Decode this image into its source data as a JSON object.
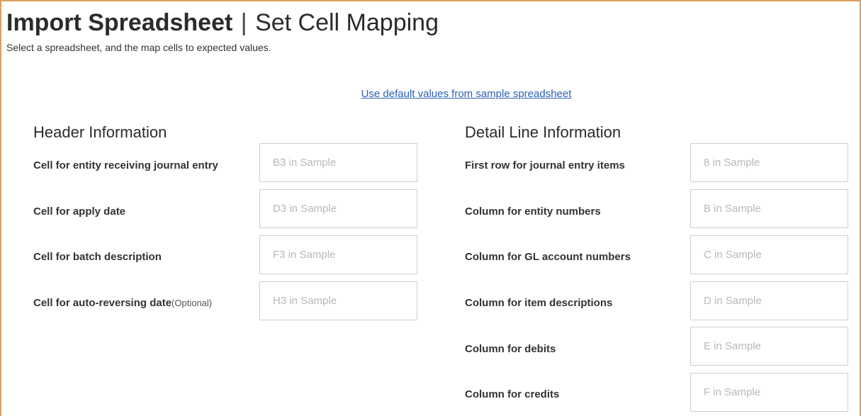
{
  "page": {
    "title_strong": "Import Spreadsheet",
    "title_separator": "|",
    "title_rest": "Set Cell Mapping",
    "subtitle": "Select a spreadsheet, and the map cells to expected values."
  },
  "default_link": "Use default values from sample spreadsheet",
  "header_section": {
    "heading": "Header Information",
    "fields": [
      {
        "label": "Cell for entity receiving journal entry",
        "placeholder": "B3 in Sample"
      },
      {
        "label": "Cell for apply date",
        "placeholder": "D3 in Sample"
      },
      {
        "label": "Cell for batch description",
        "placeholder": "F3 in Sample"
      },
      {
        "label": "Cell for auto-reversing date",
        "optional": "(Optional)",
        "placeholder": "H3 in Sample"
      }
    ]
  },
  "detail_section": {
    "heading": "Detail Line Information",
    "fields": [
      {
        "label": "First row for journal entry items",
        "placeholder": "8 in Sample"
      },
      {
        "label": "Column for entity numbers",
        "placeholder": "B in Sample"
      },
      {
        "label": "Column for GL account numbers",
        "placeholder": "C in Sample"
      },
      {
        "label": "Column for item descriptions",
        "placeholder": "D in Sample"
      },
      {
        "label": "Column for debits",
        "placeholder": "E in Sample"
      },
      {
        "label": "Column for credits",
        "placeholder": "F in Sample"
      }
    ]
  },
  "colors": {
    "frame_border": "#d9a060",
    "link": "#2b5fb3",
    "input_border": "#cfcfcf",
    "placeholder": "#b8b8b8"
  }
}
